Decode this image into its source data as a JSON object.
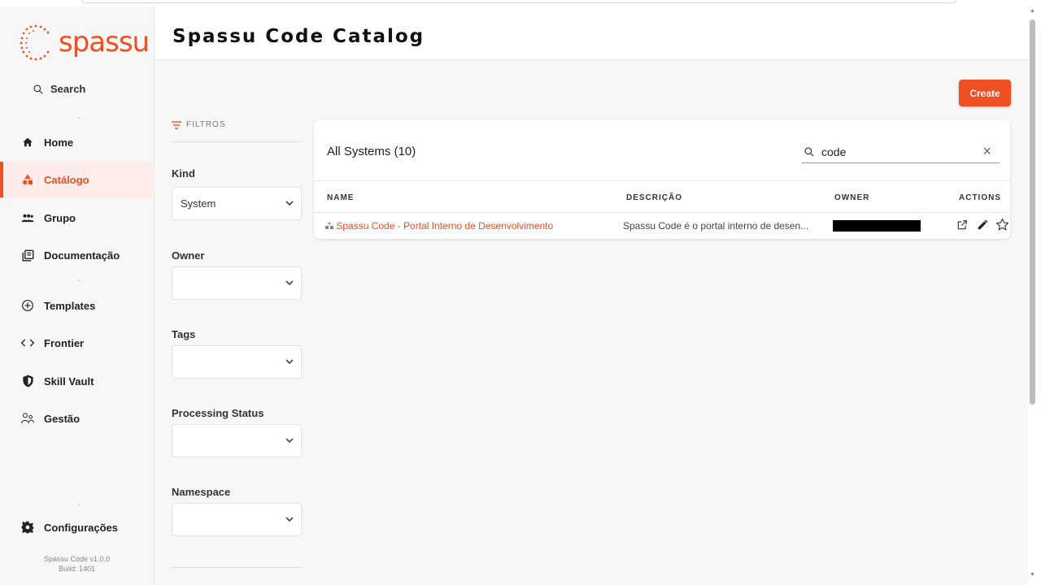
{
  "brand": {
    "logo_text": "spassu",
    "accent": "#f04e23"
  },
  "sidebar": {
    "search_label": "Search",
    "items": [
      {
        "label": "Home",
        "icon": "home-icon"
      },
      {
        "label": "Catálogo",
        "icon": "catalog-icon",
        "active": true
      },
      {
        "label": "Grupo",
        "icon": "group-icon"
      },
      {
        "label": "Documentação",
        "icon": "docs-icon"
      },
      {
        "label": "Templates",
        "icon": "add-circle-icon"
      },
      {
        "label": "Frontier",
        "icon": "code-icon"
      },
      {
        "label": "Skill Vault",
        "icon": "shield-icon"
      },
      {
        "label": "Gestão",
        "icon": "people-icon"
      }
    ],
    "settings_label": "Configurações",
    "version": "Spassu Code v1.0.0",
    "build": "Build: 1401"
  },
  "header": {
    "title": "Spassu Code Catalog"
  },
  "main": {
    "create_label": "Create",
    "filters": {
      "heading": "FILTROS",
      "kind_label": "Kind",
      "kind_value": "System",
      "owner_label": "Owner",
      "tags_label": "Tags",
      "processing_label": "Processing Status",
      "namespace_label": "Namespace"
    },
    "table": {
      "title": "All Systems (10)",
      "search_value": "code",
      "columns": [
        "NAME",
        "DESCRIÇÃO",
        "OWNER",
        "ACTIONS"
      ],
      "rows": [
        {
          "name": "Spassu Code - Portal Interno de Desenvolvimento",
          "description": "Spassu Code é o portal interno de desen..."
        }
      ]
    }
  }
}
